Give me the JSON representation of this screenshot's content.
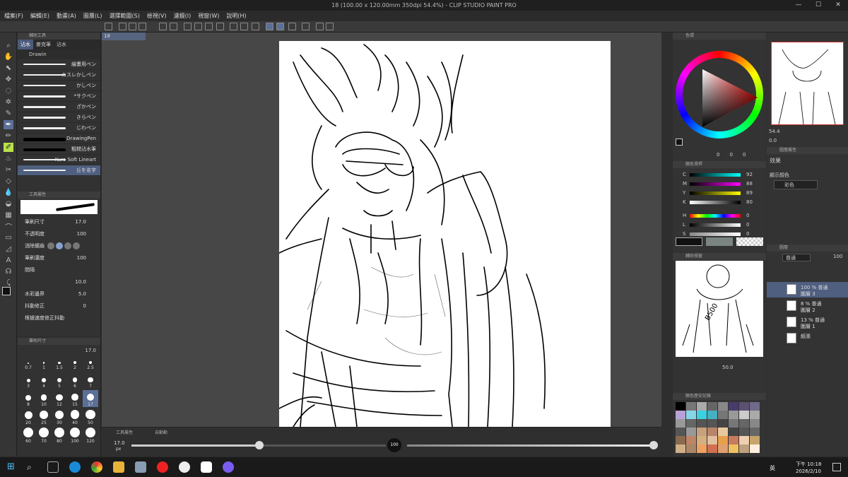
{
  "titlebar": {
    "title": "18 (100.00 x 120.00mm 350dpi 54.4%) - CLIP STUDIO PAINT PRO",
    "minimize": "—",
    "maximize": "☐",
    "close": "✕"
  },
  "menu": [
    "檔案(F)",
    "編輯(E)",
    "動畫(A)",
    "圖層(L)",
    "選擇範圍(S)",
    "檢視(V)",
    "濾鏡(I)",
    "視窗(W)",
    "說明(H)"
  ],
  "subtool": {
    "title": "輔助工具",
    "tabs": [
      "沾水",
      "麥克筆",
      "沾水"
    ],
    "group": "Drawin",
    "brushes": [
      "繪畫用ペン",
      "カスレかしペン",
      "かしペン",
      "*サクペン",
      "ざかペン",
      "きらペン",
      "じわペン",
      "DrawingPen",
      "粗糙沾水筆",
      "Kuro Soft Lineart",
      "丘を名字"
    ]
  },
  "toolprop": {
    "title": "工具屬性",
    "rows": [
      {
        "label": "筆刷尺寸",
        "value": "17.0"
      },
      {
        "label": "不透明度",
        "value": "100"
      },
      {
        "label": "消除鋸齒",
        "value": ""
      },
      {
        "label": "筆刷濃度",
        "value": "100"
      },
      {
        "label": "間隔",
        "value": ""
      },
      {
        "label": "",
        "value": "10.0"
      },
      {
        "label": "水彩邊界",
        "value": "5.0"
      },
      {
        "label": "抖動修正",
        "value": "0"
      },
      {
        "label": "根據速度修正抖動",
        "value": ""
      }
    ]
  },
  "brushsize": {
    "title": "筆刷尺寸",
    "value": "17.0",
    "sizes": [
      "0.7",
      "1",
      "1.5",
      "2",
      "2.5",
      "3",
      "4",
      "5",
      "6",
      "7",
      "8",
      "10",
      "12",
      "15",
      "17",
      "20",
      "25",
      "30",
      "40",
      "50",
      "60",
      "70",
      "80",
      "100",
      "120"
    ]
  },
  "doc": {
    "tab": "18"
  },
  "navigator": {
    "size_value": "17.0",
    "size_unit": "px",
    "opacity_badge": "100",
    "tab1": "工具屬性",
    "tab2": "自動動"
  },
  "color": {
    "title": "色環",
    "values": [
      "0",
      "0",
      "0"
    ]
  },
  "colorslider": {
    "title": "顏色滑桿",
    "rows": [
      {
        "label": "C",
        "value": "92"
      },
      {
        "label": "M",
        "value": "88"
      },
      {
        "label": "Y",
        "value": "89"
      },
      {
        "label": "K",
        "value": "80"
      },
      {
        "label": "H",
        "value": "0"
      },
      {
        "label": "L",
        "value": "0"
      },
      {
        "label": "S",
        "value": "0"
      }
    ],
    "modes": [
      "RGB",
      "CMYK",
      "HLS"
    ]
  },
  "subview": {
    "title": "輔助視窗",
    "zoom": "50.0"
  },
  "colorhistory": {
    "title": "顏色歷史記錄"
  },
  "navigator2": {
    "zoom": "54.4",
    "rotate": "0.0"
  },
  "layerprop": {
    "title": "圖層屬性",
    "effect_label": "效果",
    "display_color_label": "顯示顏色",
    "display_color_value": "彩色"
  },
  "layers": {
    "title": "圖層",
    "blend": "普通",
    "opacity": "100",
    "items": [
      {
        "name1": "100 % 普通",
        "name2": "圖層 3"
      },
      {
        "name1": "8 % 普通",
        "name2": "圖層 2"
      },
      {
        "name1": "13 % 普通",
        "name2": "圖層 1"
      },
      {
        "name1": "紙張",
        "name2": ""
      }
    ]
  },
  "taskbar": {
    "time": "下午 10:18",
    "date": "2026/2/10",
    "ime": "英"
  },
  "colors": {
    "accent": "#5b6f97",
    "lime": "#b9e24a"
  }
}
